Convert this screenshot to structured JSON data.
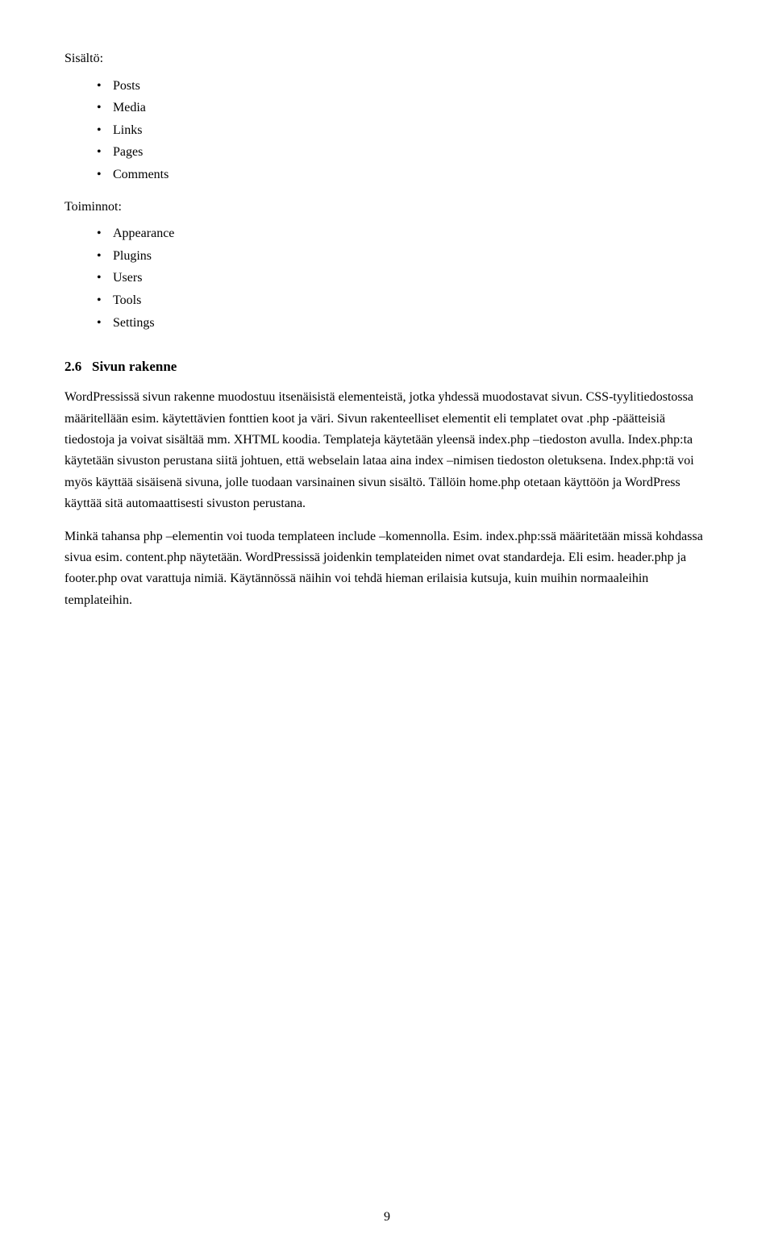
{
  "intro": {
    "label": "Sisältö:",
    "content_items": [
      "Posts",
      "Media",
      "Links",
      "Pages",
      "Comments"
    ],
    "toiminnot_label": "Toiminnot:",
    "toiminnot_items": [
      "Appearance",
      "Plugins",
      "Users",
      "Tools",
      "Settings"
    ]
  },
  "section": {
    "number": "2.6",
    "title": "Sivun rakenne",
    "paragraphs": [
      "WordPressissä sivun rakenne muodostuu itsenäisistä elementeistä, jotka yhdessä muodostavat sivun. CSS-tyylitiedostossa määritellään esim. käytettävien fonttien koot ja väri. Sivun rakenteelliset elementit eli templatet ovat .php -päätteisiä tiedostoja ja voivat sisältää mm. XHTML koodia. Templateja käytetään yleensä index.php –tiedoston avulla. Index.php:ta käytetään sivuston perustana siitä johtuen, että webselain lataa aina index –nimisen tiedoston oletuksena. Index.php:tä voi myös käyttää sisäisenä sivuna, jolle tuodaan varsinainen sivun sisältö. Tällöin home.php otetaan käyttöön ja WordPress käyttää sitä automaattisesti sivuston perustana.",
      "Minkä tahansa php –elementin voi tuoda templateen include –komennolla. Esim. index.php:ssä määritetään missä kohdassa sivua esim. content.php näytetään. WordPressissä joidenkin templateiden nimet ovat standardeja. Eli esim. header.php ja footer.php ovat varattuja nimiä. Käytännössä näihin voi tehdä hieman erilaisia kutsuja, kuin muihin normaaleihin templateihin."
    ]
  },
  "page_number": "9"
}
